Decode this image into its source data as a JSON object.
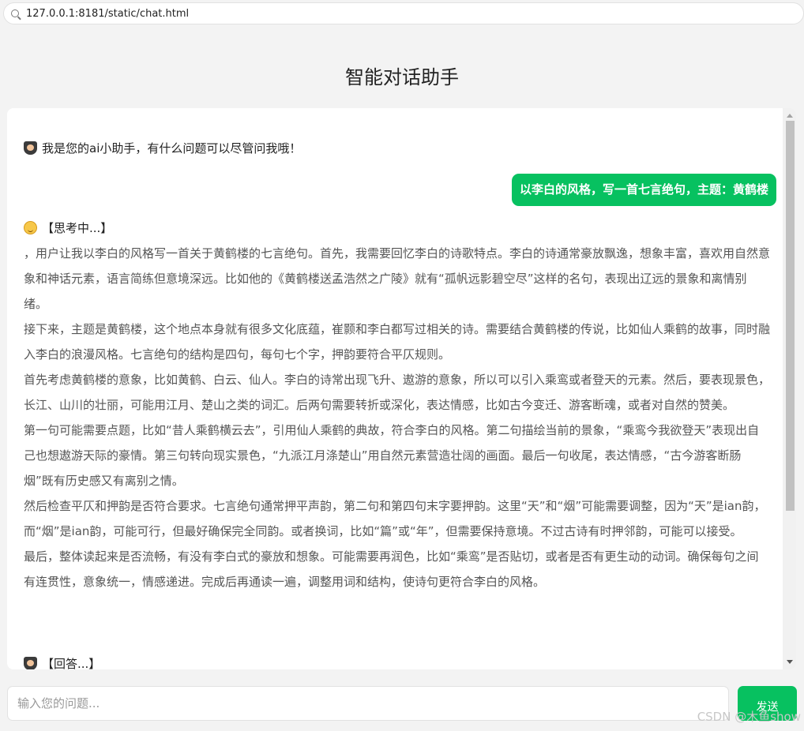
{
  "browser": {
    "url": "127.0.0.1:8181/static/chat.html"
  },
  "page": {
    "title": "智能对话助手"
  },
  "chat": {
    "bot_greeting": "我是您的ai小助手，有什么问题可以尽管问我哦！",
    "user_message": "以李白的风格，写一首七言绝句，主题：黄鹤楼",
    "thinking_label": "【思考中...】",
    "thinking_paragraphs": [
      "，用户让我以李白的风格写一首关于黄鹤楼的七言绝句。首先，我需要回忆李白的诗歌特点。李白的诗通常豪放飘逸，想象丰富，喜欢用自然意象和神话元素，语言简练但意境深远。比如他的《黄鹤楼送孟浩然之广陵》就有“孤帆远影碧空尽”这样的名句，表现出辽远的景象和离情别绪。",
      "接下来，主题是黄鹤楼，这个地点本身就有很多文化底蕴，崔颢和李白都写过相关的诗。需要结合黄鹤楼的传说，比如仙人乘鹤的故事，同时融入李白的浪漫风格。七言绝句的结构是四句，每句七个字，押韵要符合平仄规则。",
      "首先考虑黄鹤楼的意象，比如黄鹤、白云、仙人。李白的诗常出现飞升、遨游的意象，所以可以引入乘鸾或者登天的元素。然后，要表现景色，长江、山川的壮丽，可能用江月、楚山之类的词汇。后两句需要转折或深化，表达情感，比如古今变迁、游客断魂，或者对自然的赞美。",
      "第一句可能需要点题，比如“昔人乘鹤横云去”，引用仙人乘鹤的典故，符合李白的风格。第二句描绘当前的景象，“乘鸾今我欲登天”表现出自己也想遨游天际的豪情。第三句转向现实景色，“九派江月涤楚山”用自然元素营造壮阔的画面。最后一句收尾，表达情感，“古今游客断肠烟”既有历史感又有离别之情。",
      "然后检查平仄和押韵是否符合要求。七言绝句通常押平声韵，第二句和第四句末字要押韵。这里“天”和“烟”可能需要调整，因为“天”是ian韵，而“烟”是ian韵，可能可行，但最好确保完全同韵。或者换词，比如“篇”或“年”，但需要保持意境。不过古诗有时押邻韵，可能可以接受。",
      "最后，整体读起来是否流畅，有没有李白式的豪放和想象。可能需要再润色，比如“乘鸾”是否贴切，或者是否有更生动的动词。确保每句之间有连贯性，意象统一，情感递进。完成后再通读一遍，调整用词和结构，使诗句更符合李白的风格。"
    ],
    "answer_label": "【回答...】"
  },
  "input": {
    "placeholder": "输入您的问题...",
    "value": ""
  },
  "send_button": {
    "label": "发送"
  },
  "watermark": "CSDN @木鱼show",
  "colors": {
    "accent": "#07c160",
    "background": "#f3f3f3",
    "panel": "#ffffff"
  },
  "icons": {
    "bot": "graduate-emoji-icon",
    "thinking": "smiling-emoji-icon",
    "answer": "graduate-emoji-icon"
  }
}
